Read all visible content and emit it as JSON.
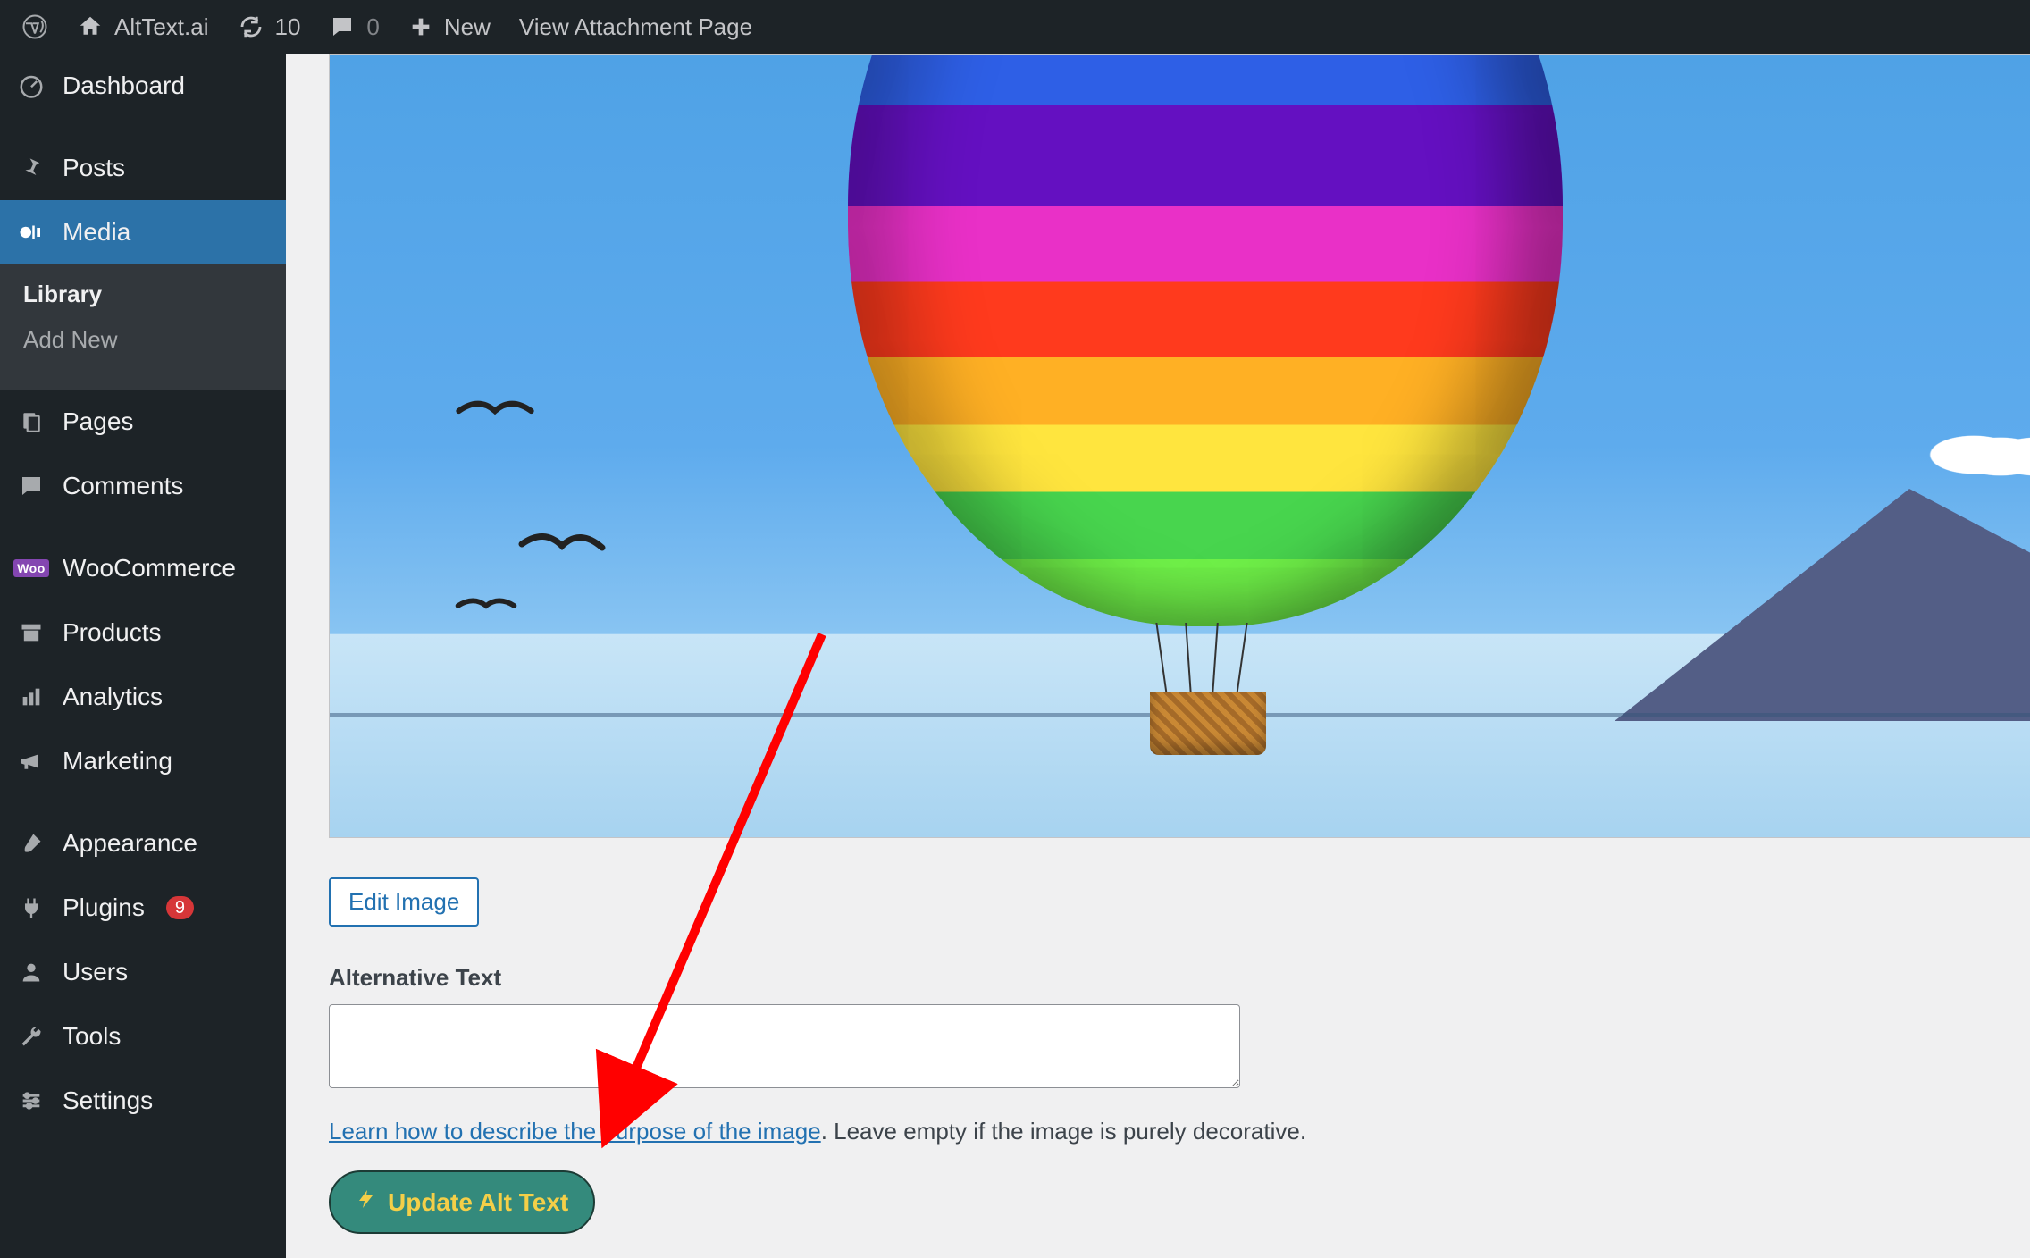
{
  "admin_bar": {
    "site_title": "AltText.ai",
    "updates_count": "10",
    "comments_count": "0",
    "new_label": "New",
    "view_attachment_label": "View Attachment Page"
  },
  "sidebar": {
    "dashboard": "Dashboard",
    "posts": "Posts",
    "media": "Media",
    "media_sub": {
      "library": "Library",
      "add_new": "Add New"
    },
    "pages": "Pages",
    "comments": "Comments",
    "woocommerce": "WooCommerce",
    "woo_badge": "Woo",
    "products": "Products",
    "analytics": "Analytics",
    "marketing": "Marketing",
    "appearance": "Appearance",
    "plugins": "Plugins",
    "plugins_badge": "9",
    "users": "Users",
    "tools": "Tools",
    "settings": "Settings"
  },
  "editor": {
    "edit_image_button": "Edit Image",
    "alt_text_label": "Alternative Text",
    "alt_text_value": "",
    "describe_link": "Learn how to describe the purpose of the image",
    "describe_tail": ". Leave empty if the image is purely decorative.",
    "update_button_label": "Update Alt Text"
  }
}
